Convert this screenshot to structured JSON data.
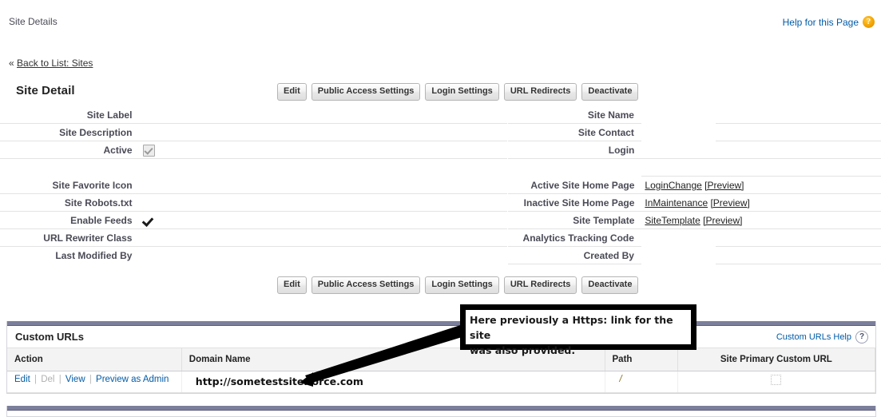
{
  "header": {
    "page_title": "Site Details",
    "help_link": "Help for this Page",
    "help_icon": "question-orb-icon",
    "help_orb_glyph": "?"
  },
  "breadcrumb": {
    "chevron": "«",
    "back_label": "Back to List: Sites"
  },
  "detail": {
    "heading": "Site Detail",
    "buttons": [
      {
        "label": "Edit"
      },
      {
        "label": "Public Access Settings"
      },
      {
        "label": "Login Settings"
      },
      {
        "label": "URL Redirects"
      },
      {
        "label": "Deactivate"
      }
    ],
    "rows": [
      {
        "left_label": "Site Label",
        "left_value": "",
        "right_label": "Site Name",
        "right_value": ""
      },
      {
        "left_label": "Site Description",
        "left_value": "",
        "right_label": "Site Contact",
        "right_value": ""
      },
      {
        "left_label": "Active",
        "left_value": "",
        "right_label": "Login",
        "right_value": ""
      },
      {
        "left_label": "",
        "left_value": "",
        "right_label": "",
        "right_value": ""
      },
      {
        "left_label": "Site Favorite Icon",
        "left_value": "",
        "right_label": "Active Site Home Page",
        "right_value": ""
      },
      {
        "left_label": "Site Robots.txt",
        "left_value": "",
        "right_label": "Inactive Site Home Page",
        "right_value": ""
      },
      {
        "left_label": "Enable Feeds",
        "left_value": "",
        "right_label": "Site Template",
        "right_value": ""
      },
      {
        "left_label": "URL Rewriter Class",
        "left_value": "",
        "right_label": "Analytics Tracking Code",
        "right_value": ""
      },
      {
        "left_label": "Last Modified By",
        "left_value": "",
        "right_label": "Created By",
        "right_value": ""
      }
    ],
    "active_checkbox": {
      "state": "checked-disabled",
      "icon": "checkbox-checked-disabled-icon"
    },
    "enable_feeds_checkbox": {
      "state": "checked",
      "icon": "checkmark-icon"
    },
    "links": {
      "active_home_page": "LoginChange",
      "active_home_page_preview": "[Preview]",
      "inactive_home_page": "InMaintenance",
      "inactive_home_page_preview": "[Preview]",
      "site_template": "SiteTemplate",
      "site_template_preview": "[Preview]"
    }
  },
  "custom_urls": {
    "title": "Custom URLs",
    "help_label": "Custom URLs Help",
    "help_icon": "question-circle-icon",
    "help_glyph": "?",
    "columns": [
      "Action",
      "Domain Name",
      "Path",
      "Site Primary Custom URL"
    ],
    "rows": [
      {
        "actions": [
          {
            "label": "Edit",
            "disabled": false
          },
          {
            "label": "Del",
            "disabled": true
          },
          {
            "label": "View",
            "disabled": false
          },
          {
            "label": "Preview as Admin",
            "disabled": false
          }
        ],
        "action_separator": "|",
        "domain_name": "http://sometestsite.force.com",
        "path": "/",
        "primary_custom_url": {
          "checked": false,
          "icon": "checkbox-empty-icon"
        }
      }
    ]
  },
  "annotation": {
    "text": "Here previously a Https: link for the site was also provided.",
    "line1": "Here previously a Https: link for the site",
    "line2": "was also provided.",
    "arrow_icon": "arrow-pointer-icon",
    "border_color": "#000000",
    "background_color": "#ffffff"
  },
  "bottom_panel": {
    "partial": true
  },
  "colors": {
    "link": "#015ba7",
    "panel_bar": "#7c7f9b",
    "label_text": "#4a4a56",
    "rule": "#e3e3e3"
  }
}
